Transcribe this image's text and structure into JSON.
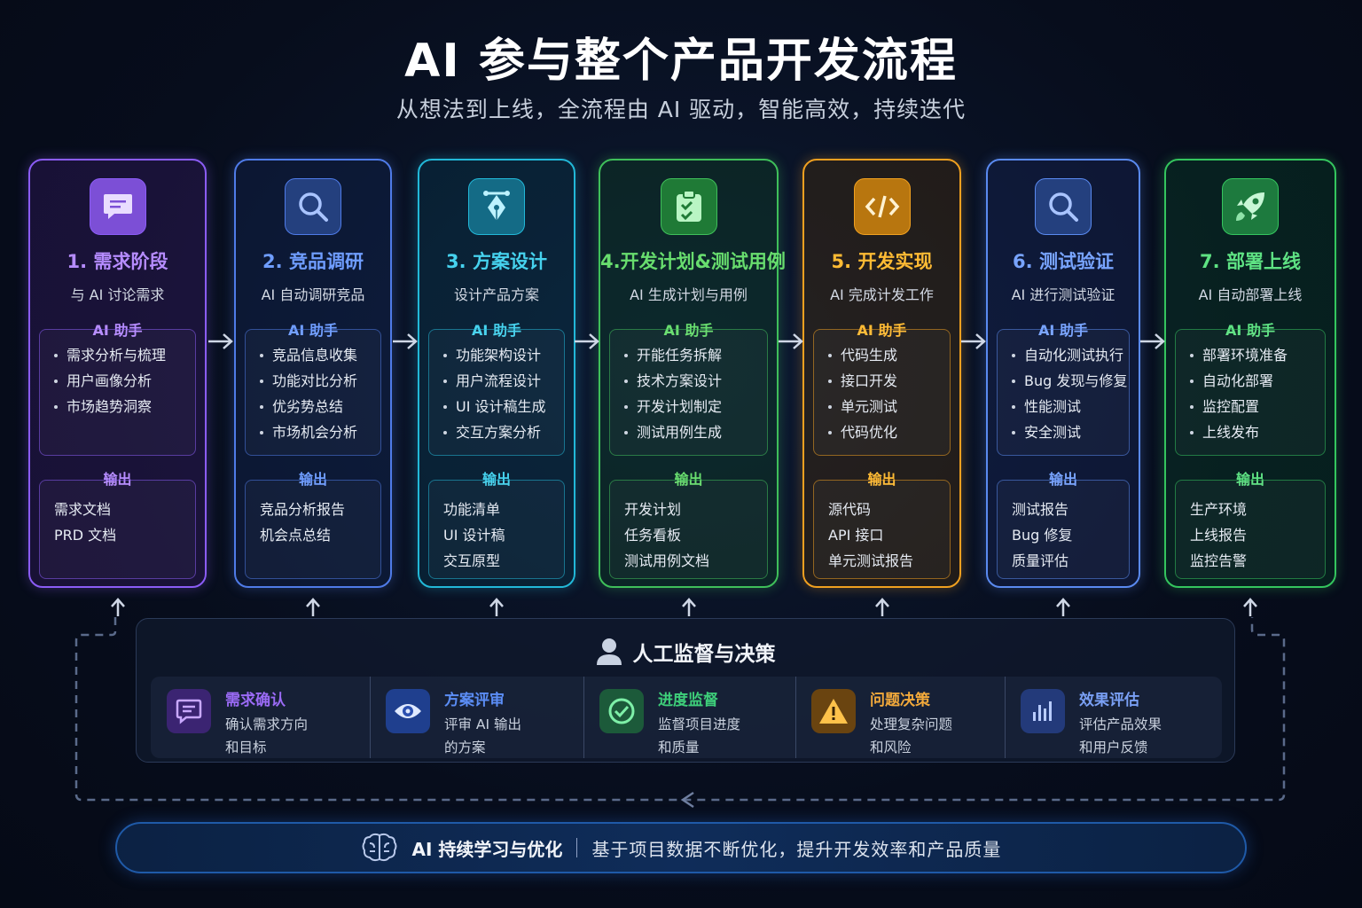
{
  "title": "AI 参与整个产品开发流程",
  "subtitle": "从想法到上线，全流程由 AI 驱动，智能高效，持续迭代",
  "ai_label": "AI 助手",
  "output_label": "输出",
  "stages": [
    {
      "title": "1. 需求阶段",
      "subtitle": "与 AI 讨论需求",
      "icon": "chat-bubble-icon",
      "color": "#8b5cf6",
      "ai_tasks": [
        "需求分析与梳理",
        "用户画像分析",
        "市场趋势洞察"
      ],
      "outputs": [
        "需求文档",
        "PRD 文档"
      ]
    },
    {
      "title": "2. 竞品调研",
      "subtitle": "AI 自动调研竞品",
      "icon": "search-icon",
      "color": "#4f7be8",
      "ai_tasks": [
        "竞品信息收集",
        "功能对比分析",
        "优劣势总结",
        "市场机会分析"
      ],
      "outputs": [
        "竞品分析报告",
        "机会点总结"
      ]
    },
    {
      "title": "3. 方案设计",
      "subtitle": "设计产品方案",
      "icon": "pen-tool-icon",
      "color": "#22b8d8",
      "ai_tasks": [
        "功能架构设计",
        "用户流程设计",
        "UI 设计稿生成",
        "交互方案分析"
      ],
      "outputs": [
        "功能清单",
        "UI 设计稿",
        "交互原型"
      ]
    },
    {
      "title": "4.开发计划&测试用例",
      "subtitle": "AI 生成计划与用例",
      "icon": "clipboard-check-icon",
      "color": "#3fbf5a",
      "ai_tasks": [
        "开能任务拆解",
        "技术方案设计",
        "开发计划制定",
        "测试用例生成"
      ],
      "outputs": [
        "开发计划",
        "任务看板",
        "测试用例文档"
      ]
    },
    {
      "title": "5. 开发实现",
      "subtitle": "AI 完成计发工作",
      "icon": "code-icon",
      "color": "#f0a020",
      "ai_tasks": [
        "代码生成",
        "接口开发",
        "单元测试",
        "代码优化"
      ],
      "outputs": [
        "源代码",
        "API 接口",
        "单元测试报告"
      ]
    },
    {
      "title": "6. 测试验证",
      "subtitle": "AI 进行测试验证",
      "icon": "search-icon",
      "color": "#5a8af0",
      "ai_tasks": [
        "自动化测试执行",
        "Bug 发现与修复",
        "性能测试",
        "安全测试"
      ],
      "outputs": [
        "测试报告",
        "Bug 修复",
        "质量评估"
      ]
    },
    {
      "title": "7. 部署上线",
      "subtitle": "AI 自动部署上线",
      "icon": "rocket-icon",
      "color": "#34c55e",
      "ai_tasks": [
        "部署环境准备",
        "自动化部署",
        "监控配置",
        "上线发布"
      ],
      "outputs": [
        "生产环境",
        "上线报告",
        "监控告警"
      ]
    }
  ],
  "supervision": {
    "title": "人工监督与决策",
    "items": [
      {
        "name": "需求确认",
        "line1": "确认需求方向",
        "line2": "和目标",
        "icon": "message-square-icon",
        "color": "#9b6bf6"
      },
      {
        "name": "方案评审",
        "line1": "评审 AI 输出",
        "line2": "的方案",
        "icon": "eye-icon",
        "color": "#5b8df5"
      },
      {
        "name": "进度监督",
        "line1": "监督项目进度",
        "line2": "和质量",
        "icon": "check-circle-icon",
        "color": "#3ecf7a"
      },
      {
        "name": "问题决策",
        "line1": "处理复杂问题",
        "line2": "和风险",
        "icon": "warning-icon",
        "color": "#f2a93b"
      },
      {
        "name": "效果评估",
        "line1": "评估产品效果",
        "line2": "和用户反馈",
        "icon": "bar-chart-icon",
        "color": "#7aa0f5"
      }
    ]
  },
  "footer": {
    "strong": "AI 持续学习与优化",
    "text": "基于项目数据不断优化，提升开发效率和产品质量"
  }
}
